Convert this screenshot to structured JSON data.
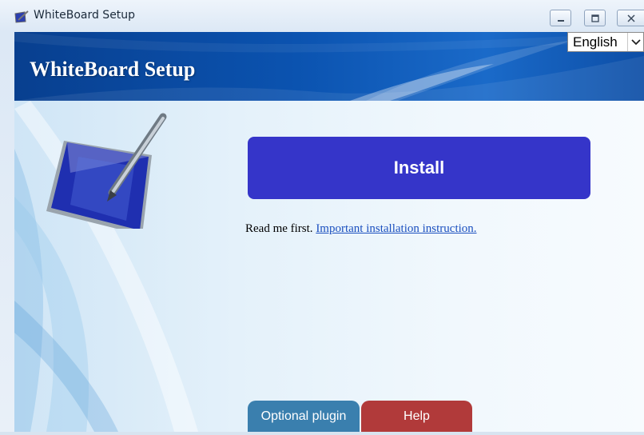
{
  "window": {
    "title": "WhiteBoard Setup",
    "controls": [
      "minimize",
      "maximize",
      "close"
    ]
  },
  "banner": {
    "title": "WhiteBoard Setup"
  },
  "language": {
    "selected": "English"
  },
  "main": {
    "install_label": "Install",
    "readme_prefix": "Read me first.",
    "readme_link": "Important installation instruction."
  },
  "tabs": [
    {
      "label": "Optional plugin",
      "color": "#3a7fae"
    },
    {
      "label": "Help",
      "color": "#b13a3a"
    }
  ],
  "colors": {
    "install_button": "#3535c9",
    "banner": "#0b53b0",
    "link": "#1a4fbf"
  },
  "icons": [
    "whiteboard-app-icon",
    "minimize-icon",
    "maximize-icon",
    "close-icon",
    "chevron-down-icon",
    "whiteboard-pen-logo"
  ]
}
